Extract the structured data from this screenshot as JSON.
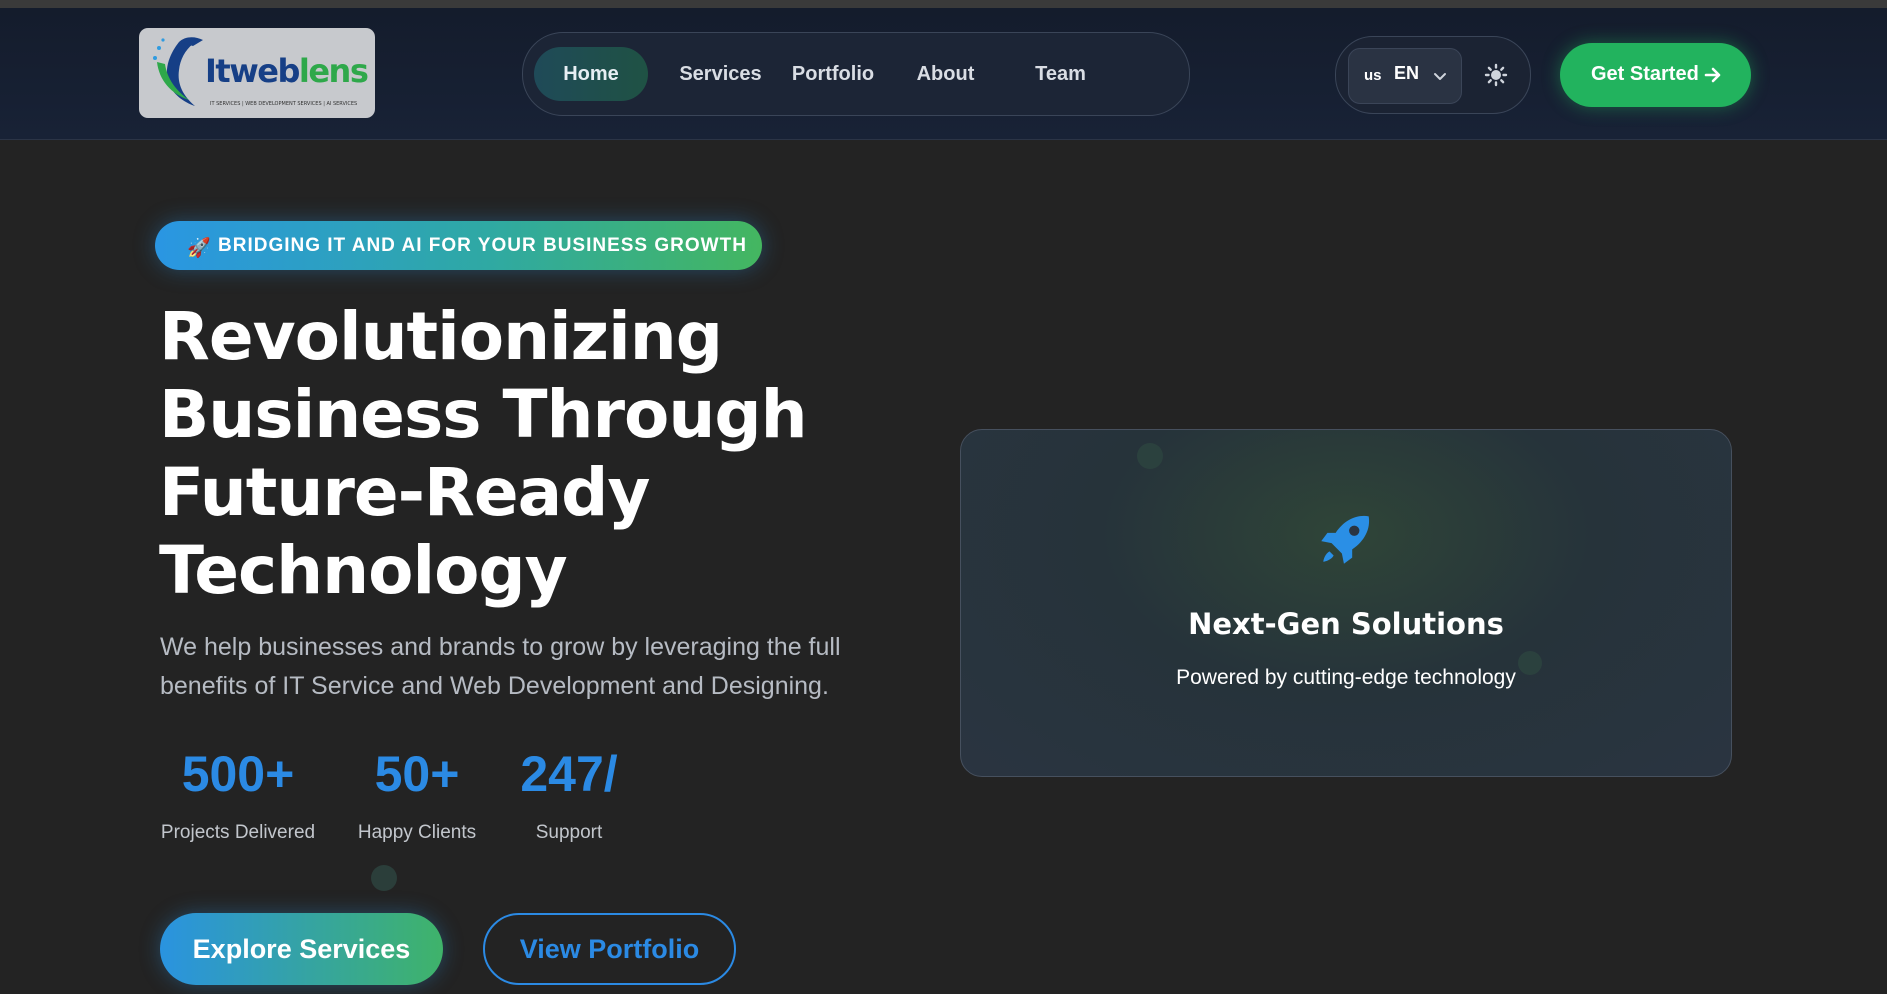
{
  "brand": {
    "name_part1": "Itweb",
    "name_part2": "lens",
    "tagline": "IT SERVICES | WEB DEVELOPMENT SERVICES | AI SERVICES",
    "logo_icon": "bird-logo-icon"
  },
  "nav": {
    "items": [
      {
        "label": "Home",
        "active": true
      },
      {
        "label": "Services",
        "active": false
      },
      {
        "label": "Portfolio",
        "active": false
      },
      {
        "label": "About",
        "active": false
      },
      {
        "label": "Team",
        "active": false
      }
    ]
  },
  "language": {
    "flag": "us",
    "code": "EN",
    "chevron_icon": "chevron-down-icon"
  },
  "theme_toggle": {
    "icon": "sun-icon"
  },
  "header_cta": {
    "label": "Get Started",
    "icon": "arrow-right-icon"
  },
  "hero": {
    "badge": {
      "emoji": "🚀",
      "text": "BRIDGING IT AND AI FOR YOUR BUSINESS GROWTH"
    },
    "title": {
      "line1": "Revolutionizing",
      "line2": "Business Through",
      "line3": "Future-Ready",
      "line4": "Technology"
    },
    "subtitle": "We help businesses and brands to grow by leveraging the full benefits of IT Service and Web Development and Designing.",
    "stats": [
      {
        "value": "500+",
        "label": "Projects Delivered"
      },
      {
        "value": "50+",
        "label": "Happy Clients"
      },
      {
        "value": "247/",
        "label": "Support"
      }
    ],
    "primary_button": "Explore Services",
    "secondary_button": "View Portfolio"
  },
  "feature_card": {
    "icon": "rocket-icon",
    "title": "Next-Gen Solutions",
    "subtitle": "Powered by cutting-edge technology"
  },
  "colors": {
    "accent_blue": "#2b8ae4",
    "accent_green": "#22b35e",
    "background": "#232323",
    "header": "#182236"
  }
}
